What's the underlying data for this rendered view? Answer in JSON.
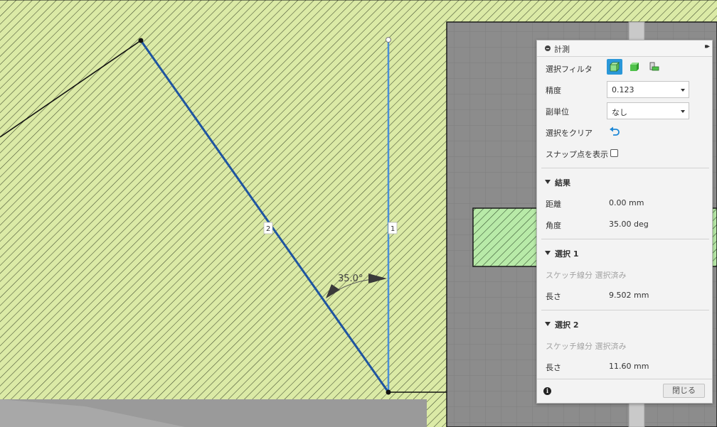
{
  "canvas": {
    "dimension_angle": "35.0°",
    "line_labels": [
      "2",
      "1"
    ]
  },
  "panel": {
    "title": "計測",
    "rows": {
      "filter_label": "選択フィルタ",
      "precision_label": "精度",
      "precision_value": "0.123",
      "subunit_label": "副単位",
      "subunit_value": "なし",
      "clear_label": "選択をクリア",
      "snap_label": "スナップ点を表示"
    },
    "results": {
      "header": "結果",
      "distance_label": "距離",
      "distance_value": "0.00 mm",
      "angle_label": "角度",
      "angle_value": "35.00 deg"
    },
    "selection1": {
      "header": "選択 1",
      "status": "スケッチ線分 選択済み",
      "length_label": "長さ",
      "length_value": "9.502 mm"
    },
    "selection2": {
      "header": "選択 2",
      "status": "スケッチ線分 選択済み",
      "length_label": "長さ",
      "length_value": "11.60 mm"
    },
    "close_label": "閉じる",
    "info_glyph": "i"
  }
}
